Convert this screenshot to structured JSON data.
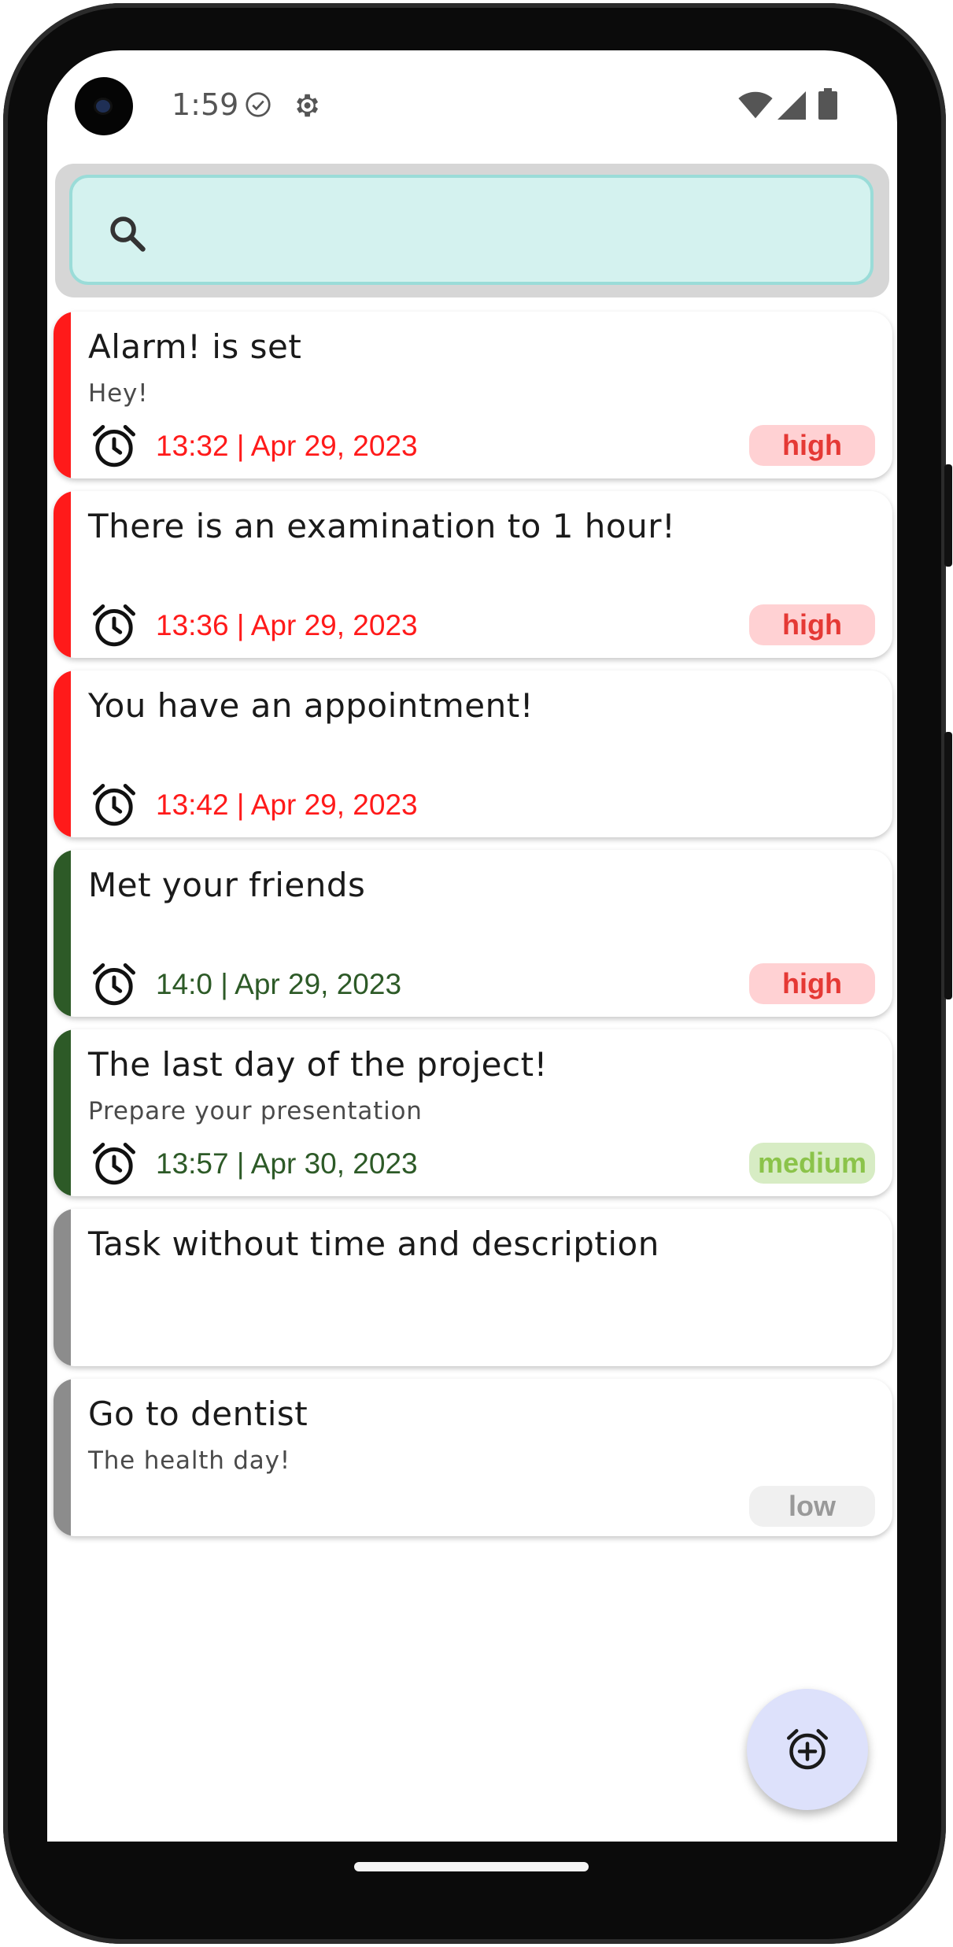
{
  "status_bar": {
    "time": "1:59"
  },
  "search": {
    "value": "",
    "placeholder": ""
  },
  "colors": {
    "red": "#ff1a1a",
    "green": "#2d5a27",
    "gray": "#8c8c8c",
    "badge_high_bg": "#ffd1d3",
    "badge_high_text": "#e53935",
    "badge_medium_bg": "#d7ecc4",
    "badge_medium_text": "#8bc34a",
    "badge_low_bg": "#f0f0f0",
    "badge_low_text": "#999999"
  },
  "tasks": [
    {
      "title": "Alarm! is set",
      "description": "Hey!",
      "time": "13:32 | Apr 29, 2023",
      "priority": "high",
      "state": "red"
    },
    {
      "title": "There is an examination to 1 hour!",
      "description": "",
      "time": "13:36 | Apr 29, 2023",
      "priority": "high",
      "state": "red"
    },
    {
      "title": "You have an appointment!",
      "description": "",
      "time": "13:42 | Apr 29, 2023",
      "priority": "",
      "state": "red"
    },
    {
      "title": "Met your friends",
      "description": "",
      "time": "14:0 | Apr 29, 2023",
      "priority": "high",
      "state": "green"
    },
    {
      "title": "The last day of the project!",
      "description": "Prepare your presentation",
      "time": "13:57 | Apr 30, 2023",
      "priority": "medium",
      "state": "green"
    },
    {
      "title": "Task without time and description",
      "description": "",
      "time": "",
      "priority": "",
      "state": "gray"
    },
    {
      "title": "Go to dentist",
      "description": "The health day!",
      "time": "",
      "priority": "low",
      "state": "gray"
    }
  ],
  "fab": {
    "icon": "add-alarm-icon"
  }
}
